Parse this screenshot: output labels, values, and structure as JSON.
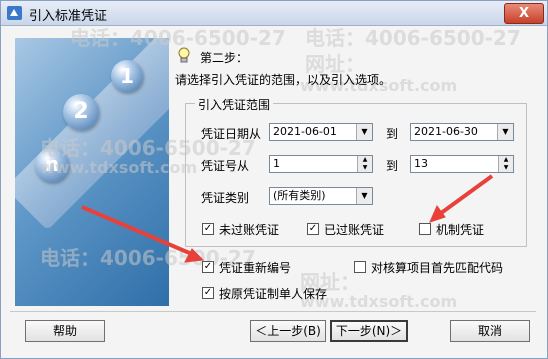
{
  "window": {
    "title": "引入标准凭证",
    "close_label": "X"
  },
  "watermarks": {
    "phone": "电话：4006-6500-27",
    "site_label": "网址：",
    "site": "www.tdxsoft.com"
  },
  "graphic": {
    "balls": [
      "1",
      "2",
      "n"
    ]
  },
  "step": {
    "title": "第二步：",
    "description": "请选择引入凭证的范围，以及引入选项。"
  },
  "range": {
    "group_label": "引入凭证范围",
    "date_label": "凭证日期从",
    "date_from": "2021-06-01",
    "to_label": "到",
    "date_to": "2021-06-30",
    "number_label": "凭证号从",
    "number_from": "1",
    "number_to": "13",
    "type_label": "凭证类别",
    "type_value": "(所有类别)",
    "chk_unposted": "未过账凭证",
    "chk_posted": "已过账凭证",
    "chk_machine": "机制凭证"
  },
  "options": {
    "renumber": "凭证重新编号",
    "match_code": "对核算项目首先匹配代码",
    "keep_maker": "按原凭证制单人保存"
  },
  "buttons": {
    "help": "帮助",
    "back": "＜上一步(B)",
    "next": "下一步(N)＞",
    "cancel": "取消"
  },
  "checked": {
    "unposted": true,
    "posted": true,
    "machine": false,
    "renumber": true,
    "match_code": false,
    "keep_maker": true
  },
  "colors": {
    "arrow": "#e8413a",
    "title_bar": "#c9d6ea",
    "close_button": "#c6412a"
  }
}
